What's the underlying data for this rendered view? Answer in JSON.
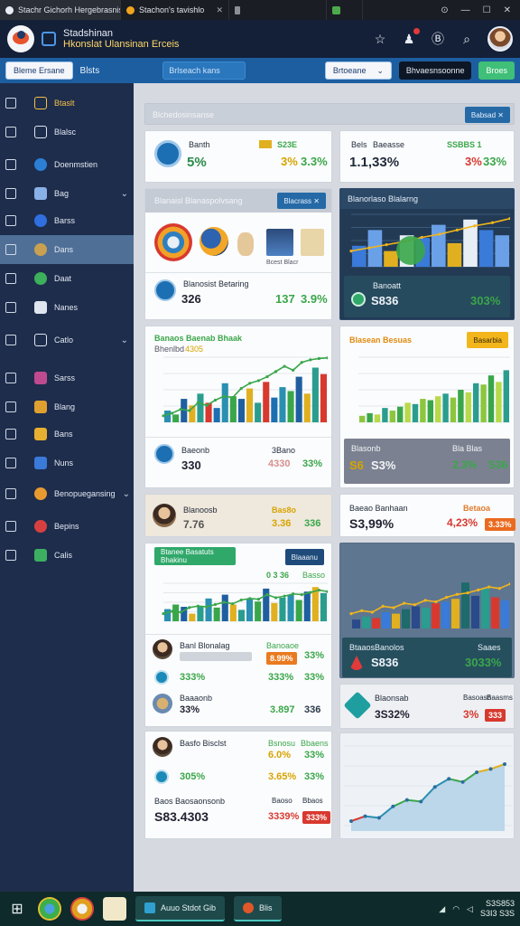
{
  "browser": {
    "tabs": [
      {
        "title": "Stachr Gichorh Hergebrasnis"
      },
      {
        "title": "Stachon's tavishlo"
      },
      {
        "title": ""
      },
      {
        "title": ""
      }
    ],
    "window_controls": [
      "⊙",
      "—",
      "☐",
      "✕"
    ]
  },
  "header": {
    "title_line1": "Stadshinan",
    "title_line2": "Hkonslat Ulansinan Erceis"
  },
  "toolbar": {
    "left_button": "Bleme Ersane",
    "left_text": "Blsts",
    "search_placeholder": "Brlseach kans",
    "filter_label": "Brtoeane",
    "export_label": "Bhvaesnsoonne",
    "new_label": "Broes"
  },
  "sidebar": {
    "items": [
      {
        "label": "Btaslt",
        "type": "outline",
        "color": "#f4c04a"
      },
      {
        "label": "Blalsc",
        "type": "outline",
        "color": "#e0e6f0"
      },
      {
        "label": "Doenmstien",
        "type": "circle",
        "color": "#2c7fd6"
      },
      {
        "label": "Bag",
        "type": "grid",
        "color": "#8ab0e8",
        "chevron": true
      },
      {
        "label": "Barss",
        "type": "circle",
        "color": "#2f6fe0"
      },
      {
        "label": "Dans",
        "type": "circle",
        "color": "#c8a050",
        "active": true
      },
      {
        "label": "Daat",
        "type": "circle",
        "color": "#3cb05a"
      },
      {
        "label": "Nanes",
        "type": "house",
        "color": "#e0e6f0"
      },
      {
        "label": "Catlo",
        "type": "outline",
        "color": "#e0e6f0",
        "chevron": true
      },
      {
        "label": "Sarss",
        "type": "square",
        "color": "#c04a90"
      },
      {
        "label": "Blang",
        "type": "square",
        "color": "#e0a030"
      },
      {
        "label": "Bans",
        "type": "square",
        "color": "#e8b030"
      },
      {
        "label": "Nuns",
        "type": "square",
        "color": "#3a7ad8"
      },
      {
        "label": "Benopuegansing",
        "type": "circle",
        "color": "#e89a30",
        "chevron": true
      },
      {
        "label": "Bepins",
        "type": "circle",
        "color": "#d84040"
      },
      {
        "label": "Calis",
        "type": "square",
        "color": "#3cb060"
      }
    ]
  },
  "main": {
    "top_header_label": "Blchedosinsanse",
    "top_header_button": "Babsad",
    "kpi_left": {
      "title": "Banth",
      "tag": "S23E",
      "value": "5%",
      "delta_label": "3%",
      "delta": "3.3%"
    },
    "kpi_right": {
      "title": "Bels",
      "subtitle": "Baeasse",
      "tag": "SSBBS 1",
      "value": "1.1,33%",
      "delta_a": "3%",
      "delta_b": "33%"
    },
    "panel_a": {
      "header": "Blanaisl Blanaspolvsang",
      "button": "Blacrass",
      "caption": "Bcest Blacr",
      "stat_title": "Blanosist Betaring",
      "stat_value": "326",
      "stat_delta_a": "137",
      "stat_delta_b": "3.9%"
    },
    "panel_b": {
      "header": "Blanorlaso Blalarng",
      "stat_title": "Banoatt",
      "stat_value": "S836",
      "stat_delta": "303%"
    },
    "panel_c": {
      "header_a": "Banaos Baenab Bhaak",
      "header_b": "Bhenlbd",
      "header_c": "4305",
      "stat_title": "Baeonb",
      "stat_value": "330",
      "stat_delta_a": "4330",
      "stat_delta_b": "33%",
      "stat_col": "3Bano"
    },
    "panel_d": {
      "header": "Blasean Besuas",
      "button": "Basarbia",
      "stat_title": "Blasonb",
      "stat_value_a": "S6",
      "stat_value_b": "S3%",
      "stat_delta_a": "2.3%",
      "stat_delta_b": "S36",
      "stat_col": "Bla Blas"
    },
    "row_e": {
      "title": "Blanoosb",
      "value": "7.76",
      "delta_label": "Bas8o",
      "delta_a": "3.36",
      "delta_b": "336"
    },
    "row_f": {
      "title": "Baeao Banhaan",
      "value": "S3,99%",
      "delta_a": "4,23%",
      "badge": "3.33%",
      "col": "Betaoa"
    },
    "panel_g": {
      "header": "Btanee Basatuts Bhakinu",
      "header_button": "Blaaanu",
      "legend_a": "0 3 36",
      "legend_b": "Basso",
      "rows": [
        {
          "title": "Banl Blonalag",
          "value": "",
          "badge": "8.99%",
          "delta": "33%"
        },
        {
          "title": "",
          "value": "333%",
          "badge": "",
          "delta_a": "333%",
          "delta": "33%"
        },
        {
          "title": "Baaaonb",
          "value": "33%",
          "delta_a": "3.897",
          "delta": "336"
        }
      ],
      "row1_col": "Banoaoe"
    },
    "panel_h": {
      "stat_title": "Banolos",
      "stat_value": "S836",
      "stat_delta": "3033%",
      "stat_col_a": "Btaaos",
      "stat_col_b": "Saaes"
    },
    "row_i": {
      "title": "Blaonsab",
      "value": "3S32%",
      "delta": "3%",
      "badge": "333",
      "col_a": "Basoasn",
      "col_b": "Baasms"
    },
    "panel_j": {
      "rows": [
        {
          "title": "Basfo Bisclst",
          "value": "",
          "delta_a": "6.0%",
          "delta_b": "33%",
          "col_a": "Bsnosu",
          "col_b": "Bbaens"
        },
        {
          "title": "",
          "value": "305%",
          "delta_a": "3.65%",
          "delta_b": "33%"
        },
        {
          "title": "Baos Baosaonsonb",
          "value": "S83.4303",
          "delta_a": "3339%",
          "badge": "333%",
          "col_a": "Baoso",
          "col_b": "Bbaos"
        }
      ]
    }
  },
  "charts": {
    "chart_a": [
      18,
      12,
      36,
      26,
      44,
      30,
      22,
      60,
      40,
      36,
      52,
      30,
      62,
      38,
      54,
      48,
      70,
      44,
      84,
      74
    ],
    "chart_b": [
      {
        "series": "blue",
        "values": [
          40,
          70,
          30,
          60,
          55,
          80,
          45,
          90,
          70,
          60
        ]
      },
      {
        "series": "trend",
        "values": [
          30,
          36,
          42,
          48,
          56,
          62,
          70,
          78,
          84,
          92
        ]
      }
    ],
    "chart_c": [
      14,
      18,
      22,
      30,
      40,
      36,
      52,
      60,
      46,
      72,
      64,
      80,
      70,
      88
    ],
    "chart_d": [
      10,
      14,
      12,
      22,
      18,
      24,
      30,
      28,
      36,
      34,
      40,
      44,
      38,
      50,
      46,
      60,
      58,
      72,
      62,
      80
    ],
    "chart_e": [
      32,
      44,
      38,
      20,
      40,
      60,
      36,
      70,
      44,
      30,
      58,
      52,
      86,
      48,
      62,
      70,
      56,
      78,
      90,
      74
    ],
    "chart_f": [
      12,
      16,
      14,
      22,
      20,
      26,
      30,
      28,
      34,
      36,
      40,
      62,
      44,
      54,
      42,
      38
    ],
    "chart_g_line": [
      10,
      16,
      14,
      28,
      36,
      34,
      52,
      62,
      58,
      70,
      74,
      80
    ]
  },
  "taskbar": {
    "active_app": "Auuo Stdot Gib",
    "active_app2": "Blis",
    "time": "S3S853",
    "date": "S3I3 S3S"
  }
}
